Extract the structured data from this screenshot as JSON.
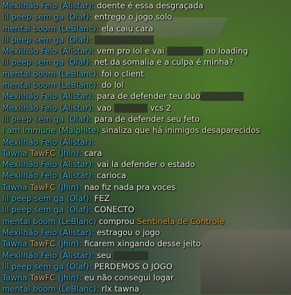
{
  "chat": {
    "lines": [
      {
        "type": "chat",
        "player": "Mexilhão Feio",
        "champion": "Alistar",
        "message": [
          "doente é essa desgraçada"
        ]
      },
      {
        "type": "chat",
        "player": "lil peep sem ga",
        "champion": "Olaf",
        "message": [
          "entrego o jogo solo"
        ]
      },
      {
        "type": "chat",
        "player": "mental boom",
        "champion": "LeBlanc",
        "message": [
          "ela caiu cara"
        ]
      },
      {
        "type": "chat",
        "player": "lil peep sem ga",
        "champion": "Olaf",
        "message": [
          {
            "redacted": true
          }
        ]
      },
      {
        "type": "chat",
        "player": "Mexilhão Feio",
        "champion": "Alistar",
        "message": [
          "vem pro lol e vai ",
          {
            "redacted": true
          },
          " no loading"
        ]
      },
      {
        "type": "chat",
        "player": "lil peep sem ga",
        "champion": "Olaf",
        "message": [
          "net da somalia e a culpa é minha?"
        ]
      },
      {
        "type": "chat",
        "player": "mental boom",
        "champion": "LeBlanc",
        "message": [
          "foi o client"
        ]
      },
      {
        "type": "chat",
        "player": "mental boom",
        "champion": "LeBlanc",
        "message": [
          "do lol"
        ]
      },
      {
        "type": "chat",
        "player": "Mexilhão Feio",
        "champion": "Alistar",
        "message": [
          "para de defender teu duo",
          {
            "redacted": true
          }
        ]
      },
      {
        "type": "chat",
        "player": "Mexilhão Feio",
        "champion": "Alistar",
        "message": [
          "vao ",
          {
            "redacted": true
          },
          " vcs 2"
        ]
      },
      {
        "type": "chat",
        "player": "lil peep sem ga",
        "champion": "Olaf",
        "message": [
          "para de defender seu feto"
        ]
      },
      {
        "type": "ping",
        "player": "I am Immune",
        "champion": "Malphite",
        "message": "sinaliza que há inimigos desaparecidos"
      },
      {
        "type": "chat",
        "player": "Mexilhão Feio",
        "champion": "Alistar",
        "message": []
      },
      {
        "type": "chat",
        "player": "Tawna",
        "tag": "TawFC",
        "champion": "Jhin",
        "message": [
          "cara"
        ]
      },
      {
        "type": "chat",
        "player": "Mexilhão Feio",
        "champion": "Alistar",
        "message": [
          "vai la defender o estado"
        ]
      },
      {
        "type": "chat",
        "player": "Mexilhão Feio",
        "champion": "Alistar",
        "message": [
          "carioca"
        ]
      },
      {
        "type": "chat",
        "player": "Tawna",
        "tag": "TawFC",
        "champion": "Jhin",
        "message": [
          "nao fiz nada pra voces"
        ]
      },
      {
        "type": "chat",
        "player": "lil peep sem ga",
        "champion": "Olaf",
        "message": [
          "FEZ"
        ]
      },
      {
        "type": "chat",
        "player": "lil peep sem ga",
        "champion": "Olaf",
        "message": [
          "CONECTO"
        ]
      },
      {
        "type": "purchase",
        "player": "mental boom",
        "champion": "LeBlanc",
        "message": "comprou",
        "item": "Sentinela de Controle"
      },
      {
        "type": "chat",
        "player": "Mexilhão Feio",
        "champion": "Alistar",
        "message": [
          "estragou o jogo"
        ]
      },
      {
        "type": "chat",
        "player": "Tawna",
        "tag": "TawFC",
        "champion": "Jhin",
        "message": [
          "ficarem xingando desse jeito"
        ]
      },
      {
        "type": "chat",
        "player": "Mexilhão Feio",
        "champion": "Alistar",
        "message": [
          "seu ",
          {
            "redacted": true
          }
        ]
      },
      {
        "type": "chat",
        "player": "lil peep sem ga",
        "champion": "Olaf",
        "message": [
          "PERDEMOS O JOGO"
        ]
      },
      {
        "type": "chat",
        "player": "Tawna",
        "tag": "TawFC",
        "champion": "Jhin",
        "message": [
          "eu não consegui logar"
        ]
      },
      {
        "type": "chat",
        "player": "mental boom",
        "champion": "LeBlanc",
        "message": [
          "rlx tawna"
        ]
      }
    ]
  },
  "colors": {
    "player": "#3ea6d6",
    "tag": "#c7a46c",
    "message": "#ecebe4",
    "ping_player": "#3fb9ac",
    "ping_message": "#eed8cc",
    "item": "#e8972a"
  }
}
